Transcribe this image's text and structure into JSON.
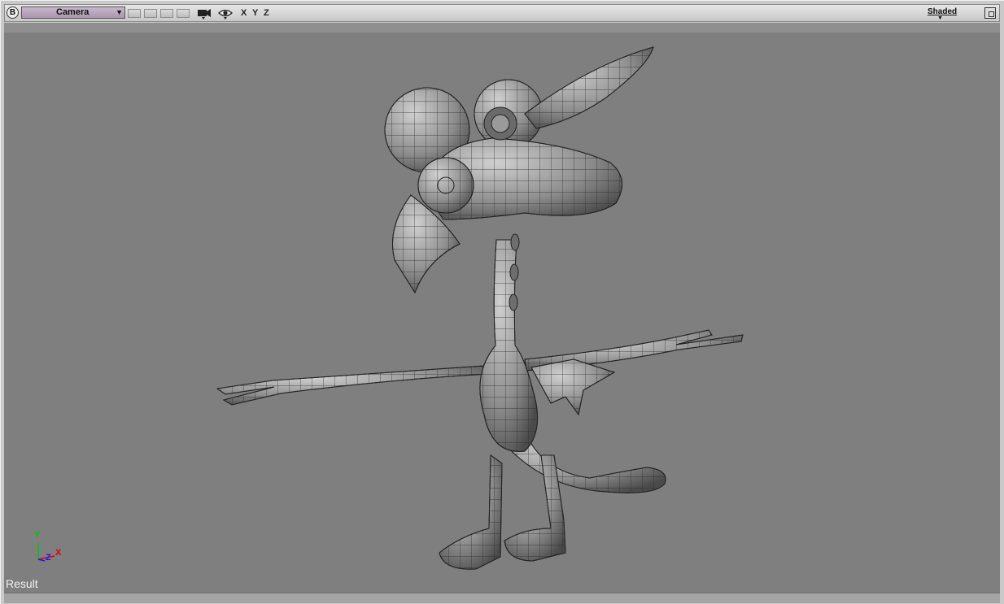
{
  "toolbar": {
    "badge": "B",
    "camera": "Camera",
    "axes": [
      "X",
      "Y",
      "Z"
    ],
    "shading_mode": "Shaded"
  },
  "viewport": {
    "label": "Result",
    "gizmo": {
      "y": "Y",
      "x": "X",
      "z": "Z"
    }
  },
  "icons": [
    "camera-icon",
    "eye-icon",
    "maximize-icon",
    "axis-gizmo-icon"
  ],
  "colors": {
    "viewport_bg": "#7f7f7f",
    "mesh_fill": "#9a9a9a",
    "wire": "#2a2a2a",
    "camera_select": "#b9a6bd",
    "axis_y": "#00c800",
    "axis_x": "#e00000",
    "axis_z": "#1a1aff"
  }
}
